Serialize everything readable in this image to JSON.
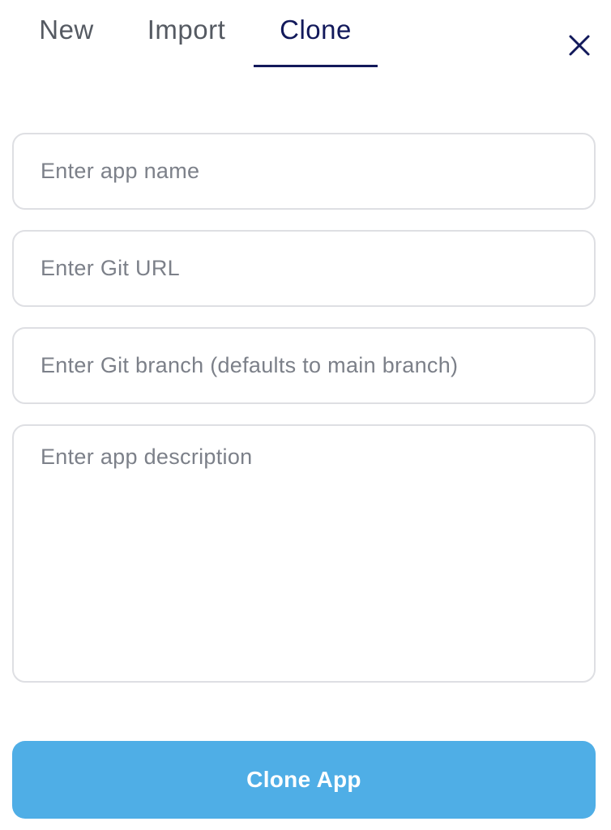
{
  "tabs": [
    {
      "label": "New",
      "active": false
    },
    {
      "label": "Import",
      "active": false
    },
    {
      "label": "Clone",
      "active": true
    }
  ],
  "close_icon": "close-icon",
  "form": {
    "app_name": {
      "value": "",
      "placeholder": "Enter app name"
    },
    "git_url": {
      "value": "",
      "placeholder": "Enter Git URL"
    },
    "git_branch": {
      "value": "",
      "placeholder": "Enter Git branch (defaults to main branch)"
    },
    "description": {
      "value": "",
      "placeholder": "Enter app description"
    }
  },
  "submit": {
    "label": "Clone App"
  },
  "colors": {
    "accent": "#12195b",
    "button": "#4faee6",
    "border": "#dedfe3",
    "placeholder": "#7c8089",
    "inactive_tab": "#555a62"
  }
}
